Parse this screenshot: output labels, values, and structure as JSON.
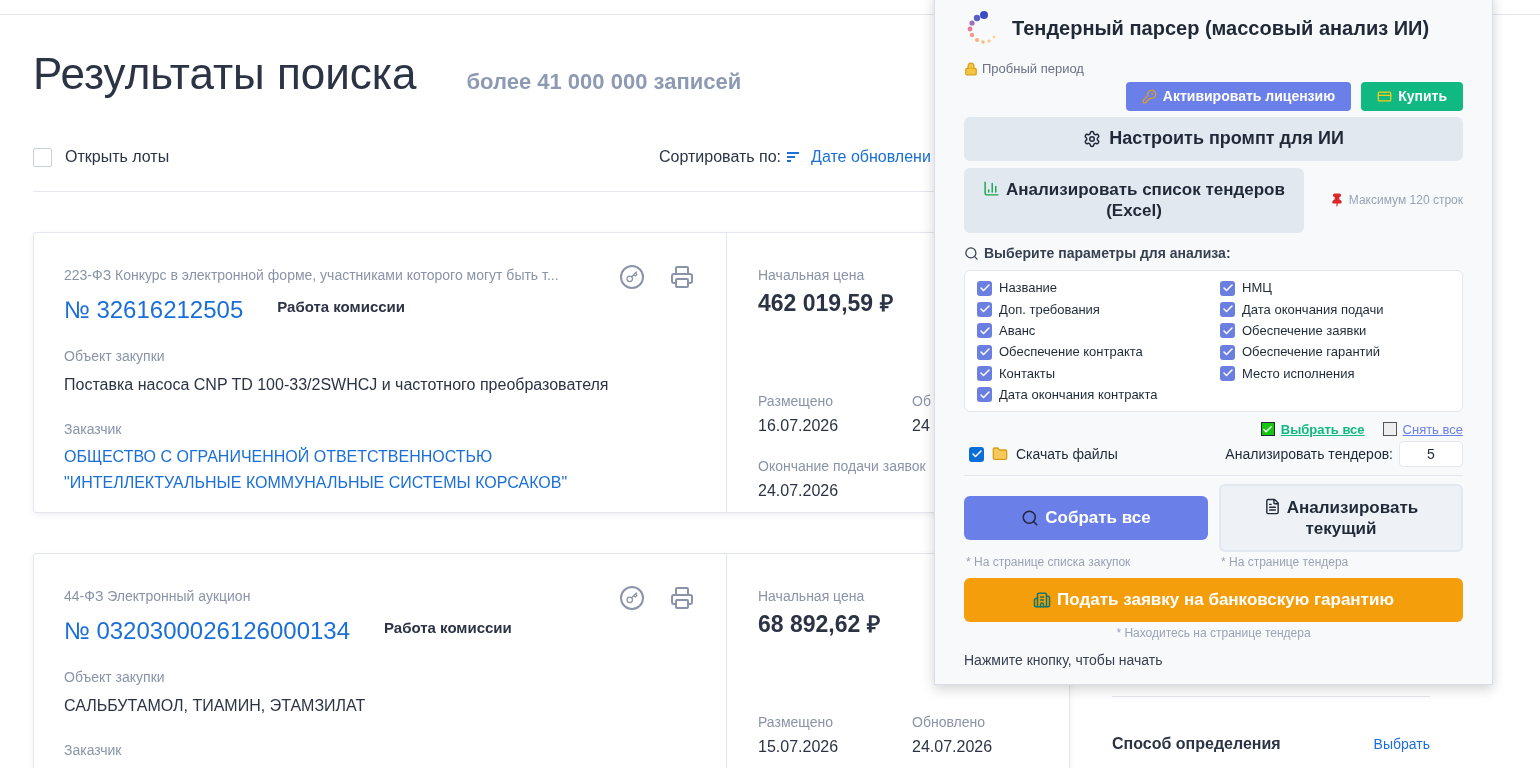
{
  "page": {
    "title": "Результаты поиска",
    "count": "более 41 000 000 записей"
  },
  "toolbar": {
    "open_lots": {
      "label": "Открыть лоты",
      "checked": false
    },
    "sort_label": "Сортировать по:",
    "sort_value": "Дате обновлени"
  },
  "cards": [
    {
      "law": "223-ФЗ Конкурс в электронной форме, участниками которого могут быть т...",
      "number": "№ 32616212505",
      "status": "Работа комиссии",
      "object_label": "Объект закупки",
      "object": "Поставка насоса CNP TD 100-33/2SWHCJ и частотного преобразователя",
      "customer_label": "Заказчик",
      "customer": "ОБЩЕСТВО С ОГРАНИЧЕННОЙ ОТВЕТСТВЕННОСТЬЮ \"ИНТЕЛЛЕКТУАЛЬНЫЕ КОММУНАЛЬНЫЕ СИСТЕМЫ КОРСАКОВ\"",
      "price_label": "Начальная цена",
      "price": "462 019,59 ₽",
      "placed_label": "Размещено",
      "placed": "16.07.2026",
      "updated_label": "Об",
      "updated": "24",
      "deadline_label": "Окончание подачи заявок",
      "deadline": "24.07.2026"
    },
    {
      "law": "44-ФЗ Электронный аукцион",
      "number": "№ 0320300026126000134",
      "status": "Работа комиссии",
      "object_label": "Объект закупки",
      "object": "САЛЬБУТАМОЛ, ТИАМИН, ЭТАМЗИЛАТ",
      "customer_label": "Заказчик",
      "price_label": "Начальная цена",
      "price": "68 892,62 ₽",
      "placed_label": "Размещено",
      "placed": "15.07.2026",
      "updated_label": "Обновлено",
      "updated": "24.07.2026"
    }
  ],
  "sidebar": {
    "filter_title": "Способ определения",
    "filter_action": "Выбрать"
  },
  "extension": {
    "title": "Тендерный парсер (массовый анализ ИИ)",
    "trial": "Пробный период",
    "activate": "Активировать лицензию",
    "buy": "Купить",
    "prompt": "Настроить промпт для ИИ",
    "analyze_list": "Анализировать список тендеров (Excel)",
    "max_note": "Максимум 120 строк",
    "params_title": "Выберите параметры для анализа:",
    "param_columns": [
      {
        "items": [
          {
            "label": "Название",
            "checked": true
          },
          {
            "label": "Доп. требования",
            "checked": true
          },
          {
            "label": "Аванс",
            "checked": true
          },
          {
            "label": "Обеспечение контракта",
            "checked": true
          },
          {
            "label": "Контакты",
            "checked": true
          },
          {
            "label": "Дата окончания контракта",
            "checked": true
          }
        ]
      },
      {
        "items": [
          {
            "label": "НМЦ",
            "checked": true
          },
          {
            "label": "Дата окончания подачи",
            "checked": true
          },
          {
            "label": "Обеспечение заявки",
            "checked": true
          },
          {
            "label": "Обеспечение гарантий",
            "checked": true
          },
          {
            "label": "Место исполнения",
            "checked": true
          }
        ]
      }
    ],
    "select_all": "Выбрать все",
    "clear_all": "Снять все",
    "download": {
      "label": "Скачать файлы",
      "checked": true
    },
    "count_label": "Анализировать тендеров:",
    "count_value": "5",
    "collect": "Собрать все",
    "collect_note": "* На странице списка закупок",
    "analyze_current": "Анализировать текущий",
    "analyze_note": "* На странице тендера",
    "guarantee": "Подать заявку на банковскую гарантию",
    "guarantee_note": "* Находитесь на странице тендера",
    "status": "Нажмите кнопку, чтобы начать"
  }
}
